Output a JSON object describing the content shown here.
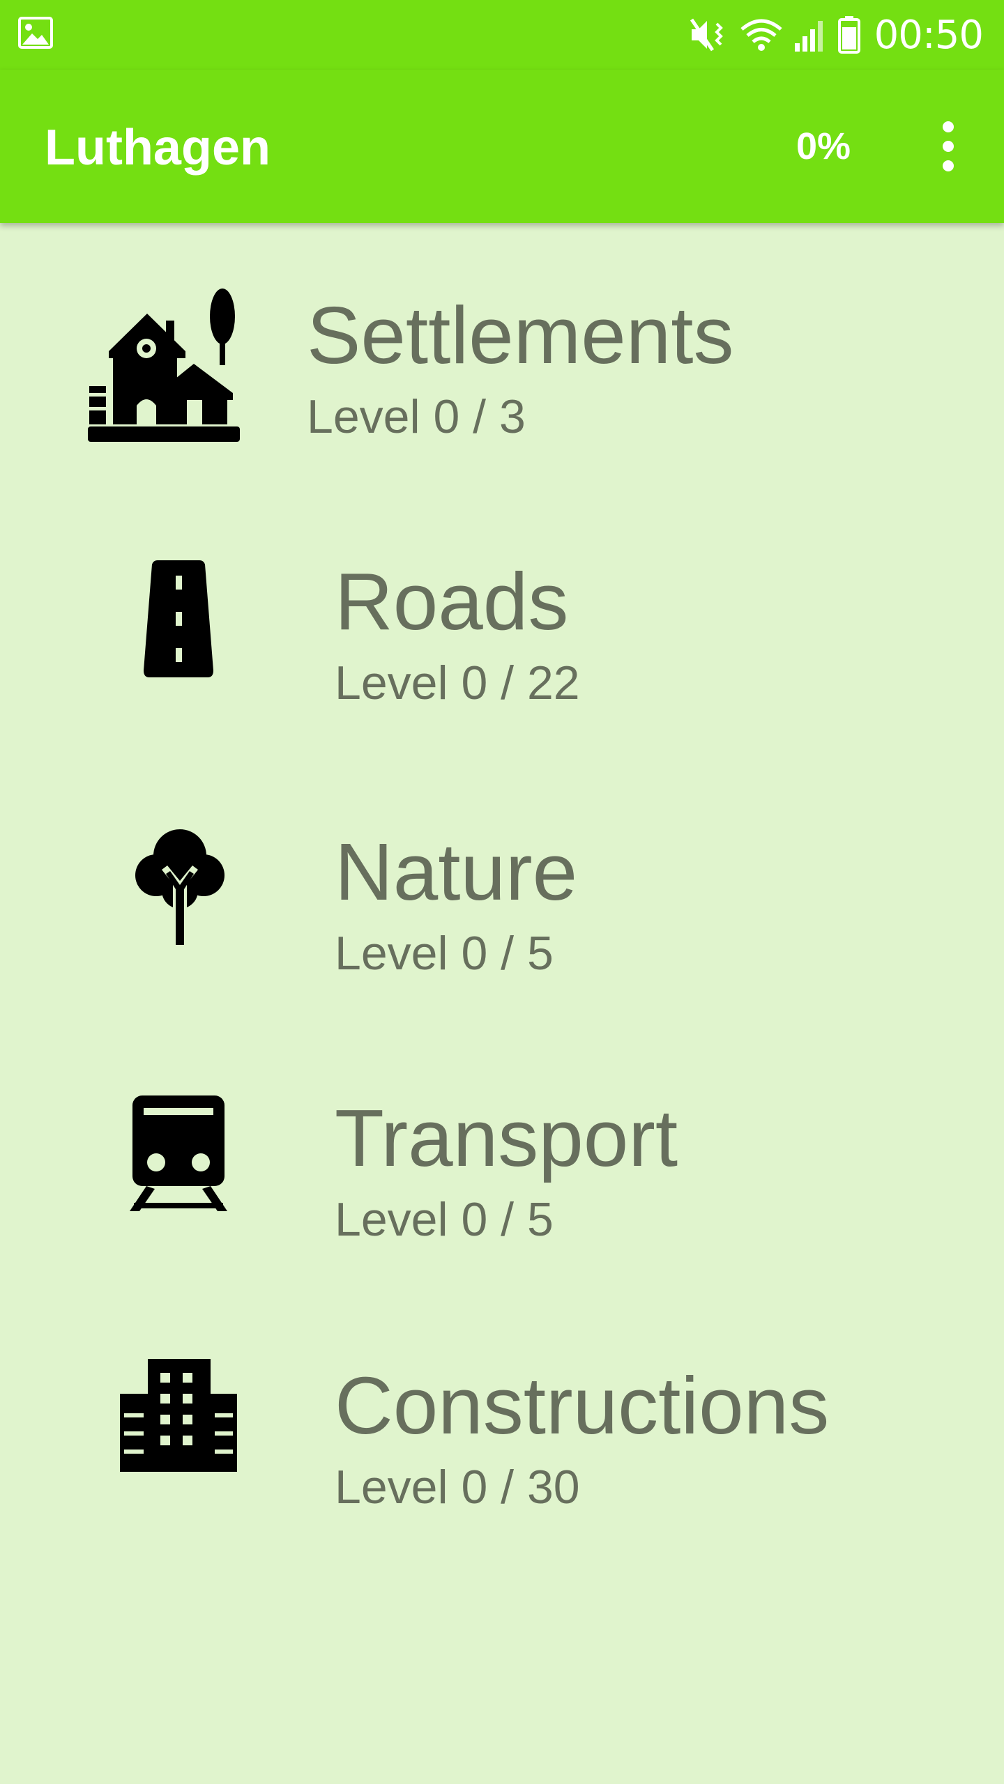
{
  "status_bar": {
    "left_icon": "gallery-icon",
    "icons": [
      "mute-vibrate-icon",
      "wifi-icon",
      "cell-signal-icon",
      "battery-icon"
    ],
    "time": "00:50"
  },
  "app_bar": {
    "title": "Luthagen",
    "progress": "0%",
    "menu_icon": "overflow-menu-icon"
  },
  "colors": {
    "accent": "#74df12",
    "background": "#e0f4cd",
    "text": "#676f5d",
    "icon": "#000000"
  },
  "categories": [
    {
      "name": "Settlements",
      "level": "Level 0 / 3",
      "icon": "settlement-icon"
    },
    {
      "name": "Roads",
      "level": "Level 0 / 22",
      "icon": "road-icon"
    },
    {
      "name": "Nature",
      "level": "Level 0 / 5",
      "icon": "tree-icon"
    },
    {
      "name": "Transport",
      "level": "Level 0 / 5",
      "icon": "train-icon"
    },
    {
      "name": "Constructions",
      "level": "Level 0 / 30",
      "icon": "building-icon"
    }
  ]
}
